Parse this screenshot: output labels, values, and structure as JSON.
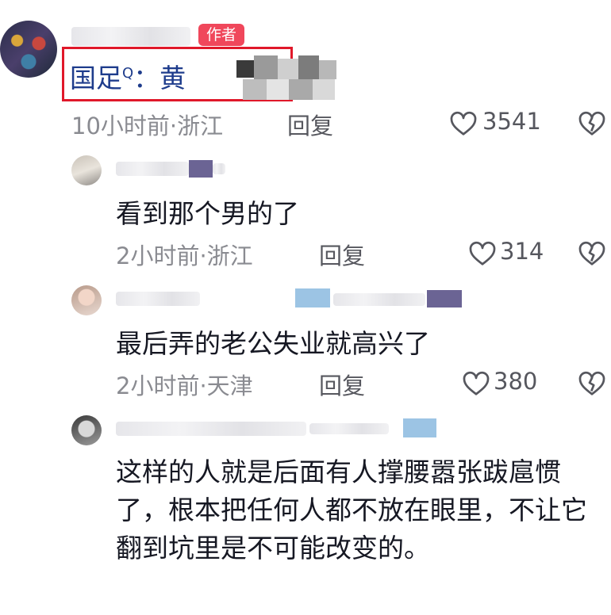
{
  "root_comment": {
    "author_badge": "作者",
    "text_prefix": "国足",
    "text_search_mark": "Q",
    "text_suffix": "：黄",
    "time": "10小时前",
    "location": "浙江",
    "reply_label": "回复",
    "likes": "3541"
  },
  "replies": [
    {
      "text": "看到那个男的了",
      "time": "2小时前",
      "location": "浙江",
      "reply_label": "回复",
      "likes": "314"
    },
    {
      "text": "最后弄的老公失业就高兴了",
      "time": "2小时前",
      "location": "天津",
      "reply_label": "回复",
      "likes": "380"
    },
    {
      "text": "这样的人就是后面有人撑腰嚣张跋扈惯了，根本把任何人都不放在眼里，不让它翻到坑里是不可能改变的。"
    }
  ],
  "separator": "·",
  "icons": {
    "like": "heart-outline-icon",
    "dislike": "broken-heart-icon",
    "search_mark": "search-icon"
  },
  "colors": {
    "highlight_border": "#e0182a",
    "author_badge_bg": "#f0475b",
    "link_text": "#1e3c8c",
    "meta_text": "#8a8b91"
  }
}
